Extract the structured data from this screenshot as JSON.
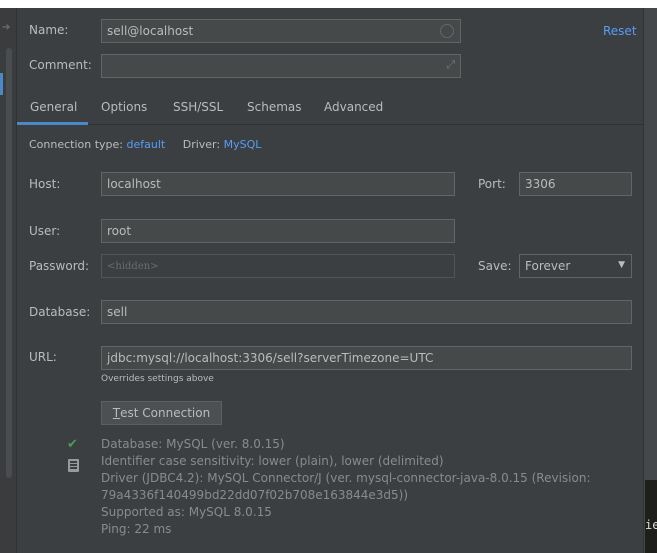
{
  "form": {
    "name_label": "Name:",
    "name_value": "sell@localhost",
    "comment_label": "Comment:",
    "comment_value": "",
    "reset_label": "Reset"
  },
  "tabs": [
    {
      "label": "General",
      "active": true
    },
    {
      "label": "Options"
    },
    {
      "label": "SSH/SSL"
    },
    {
      "label": "Schemas"
    },
    {
      "label": "Advanced"
    }
  ],
  "general": {
    "conn_type_label": "Connection type:",
    "conn_type_value": "default",
    "driver_label": "Driver:",
    "driver_value": "MySQL",
    "host_label": "Host:",
    "host_value": "localhost",
    "port_label": "Port:",
    "port_value": "3306",
    "user_label": "User:",
    "user_value": "root",
    "password_label": "Password:",
    "password_placeholder": "<hidden>",
    "save_label": "Save:",
    "save_value": "Forever",
    "database_label": "Database:",
    "database_value": "sell",
    "url_label": "URL:",
    "url_value": "jdbc:mysql://localhost:3306/sell?serverTimezone=UTC",
    "url_hint": "Overrides settings above",
    "test_button_underline": "T",
    "test_button_rest": "est Connection"
  },
  "result": {
    "lines": [
      "Database: MySQL (ver. 8.0.15)",
      "Identifier case sensitivity: lower (plain), lower (delimited)",
      "Driver (JDBC4.2): MySQL Connector/J (ver. mysql-connector-java-8.0.15 (Revision:",
      "79a4336f140499bd22dd07f02b708e163844e3d5))",
      "Supported as: MySQL 8.0.15",
      "Ping: 22 ms"
    ],
    "status_icon": "check-icon",
    "copy_icon": "copy-icon",
    "status_color": "#499c54"
  },
  "background": {
    "peek_text": "ie"
  },
  "colors": {
    "accent": "#4a88c7",
    "link": "#589df6"
  }
}
